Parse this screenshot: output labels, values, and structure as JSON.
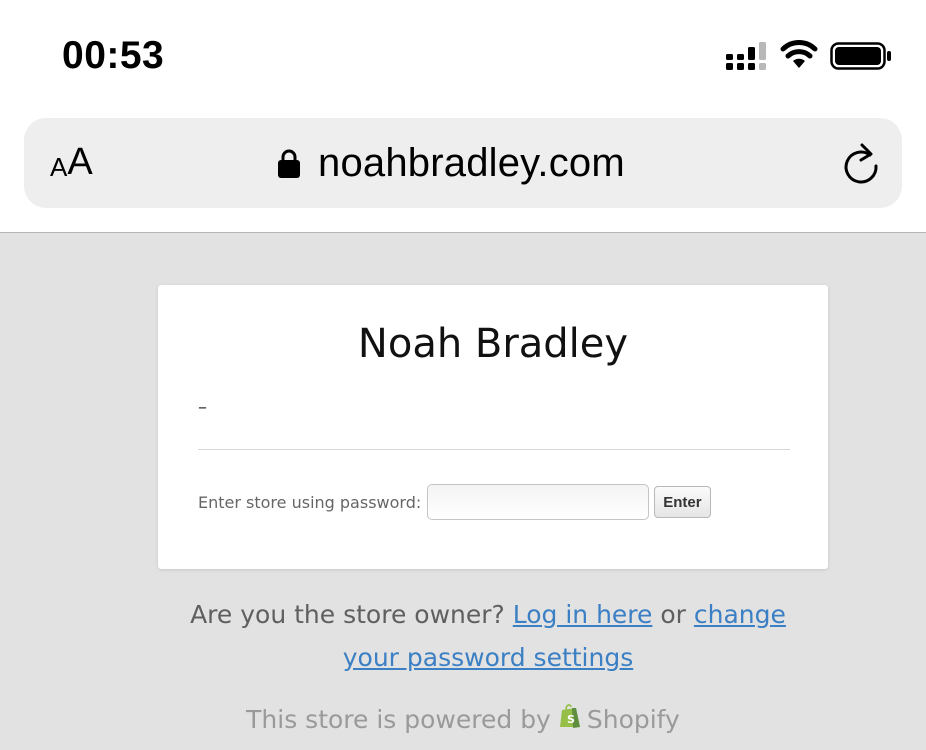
{
  "status_bar": {
    "time": "00:53",
    "icons": [
      "cellular-signal-icon",
      "wifi-icon",
      "battery-icon"
    ]
  },
  "browser": {
    "text_size_small": "A",
    "text_size_big": "A",
    "url": "noahbradley.com",
    "icons": [
      "lock-icon",
      "reload-icon"
    ]
  },
  "card": {
    "title": "Noah Bradley",
    "message": "–",
    "password_label": "Enter store using password:",
    "enter_button": "Enter"
  },
  "owner": {
    "prefix": "Are you the store owner? ",
    "login_link": "Log in here",
    "middle": " or ",
    "settings_link": "change your password settings"
  },
  "footer": {
    "powered_text": "This store is powered by",
    "brand": "Shopify"
  },
  "colors": {
    "page_background": "#e2e2e2",
    "link": "#3b7fc4",
    "shopify_green": "#95bf47"
  }
}
